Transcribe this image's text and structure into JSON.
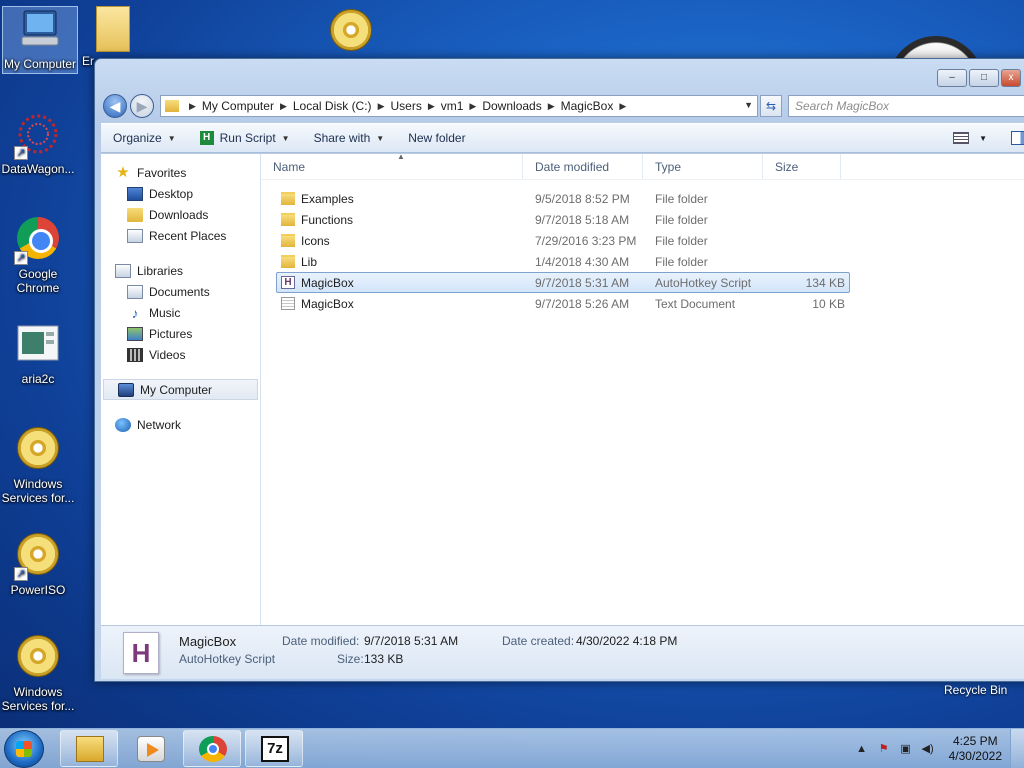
{
  "desktop": {
    "icons": [
      {
        "label": "My Computer"
      },
      {
        "label": "DataWagon..."
      },
      {
        "label": "Google Chrome"
      },
      {
        "label": "aria2c"
      },
      {
        "label": "Windows Services for..."
      },
      {
        "label": "PowerISO"
      },
      {
        "label": "Windows Services for..."
      }
    ],
    "partial_icon_label": "Er",
    "recycle_bin_label": "Recycle Bin"
  },
  "window": {
    "breadcrumb": [
      "My Computer",
      "Local Disk (C:)",
      "Users",
      "vm1",
      "Downloads",
      "MagicBox"
    ],
    "search_placeholder": "Search MagicBox",
    "controls": {
      "minimize": "–",
      "maximize": "□",
      "close": "x"
    }
  },
  "toolbar": {
    "organize": "Organize",
    "run_script": "Run Script",
    "share_with": "Share with",
    "new_folder": "New folder"
  },
  "nav": {
    "favorites": "Favorites",
    "desktop": "Desktop",
    "downloads": "Downloads",
    "recent_places": "Recent Places",
    "libraries": "Libraries",
    "documents": "Documents",
    "music": "Music",
    "pictures": "Pictures",
    "videos": "Videos",
    "my_computer": "My Computer",
    "network": "Network"
  },
  "columns": {
    "name": "Name",
    "date": "Date modified",
    "type": "Type",
    "size": "Size"
  },
  "files": [
    {
      "name": "Examples",
      "date": "9/5/2018 8:52 PM",
      "type": "File folder",
      "size": "",
      "icon": "folder-icon"
    },
    {
      "name": "Functions",
      "date": "9/7/2018 5:18 AM",
      "type": "File folder",
      "size": "",
      "icon": "folder-icon"
    },
    {
      "name": "Icons",
      "date": "7/29/2016 3:23 PM",
      "type": "File folder",
      "size": "",
      "icon": "folder-icon"
    },
    {
      "name": "Lib",
      "date": "1/4/2018 4:30 AM",
      "type": "File folder",
      "size": "",
      "icon": "folder-icon"
    },
    {
      "name": "MagicBox",
      "date": "9/7/2018 5:31 AM",
      "type": "AutoHotkey Script",
      "size": "134 KB",
      "icon": "autohotkey-script-icon",
      "selected": true
    },
    {
      "name": "MagicBox",
      "date": "9/7/2018 5:26 AM",
      "type": "Text Document",
      "size": "10 KB",
      "icon": "text-document-icon"
    }
  ],
  "details": {
    "name": "MagicBox",
    "type": "AutoHotkey Script",
    "date_modified_label": "Date modified:",
    "date_modified": "9/7/2018 5:31 AM",
    "date_created_label": "Date created:",
    "date_created": "4/30/2022 4:18 PM",
    "size_label": "Size:",
    "size": "133 KB"
  },
  "taskbar": {
    "time": "4:25 PM",
    "date": "4/30/2022",
    "apps": [
      "windows-explorer",
      "windows-media-player",
      "google-chrome",
      "7-zip"
    ],
    "seven_zip_label": "7z"
  }
}
